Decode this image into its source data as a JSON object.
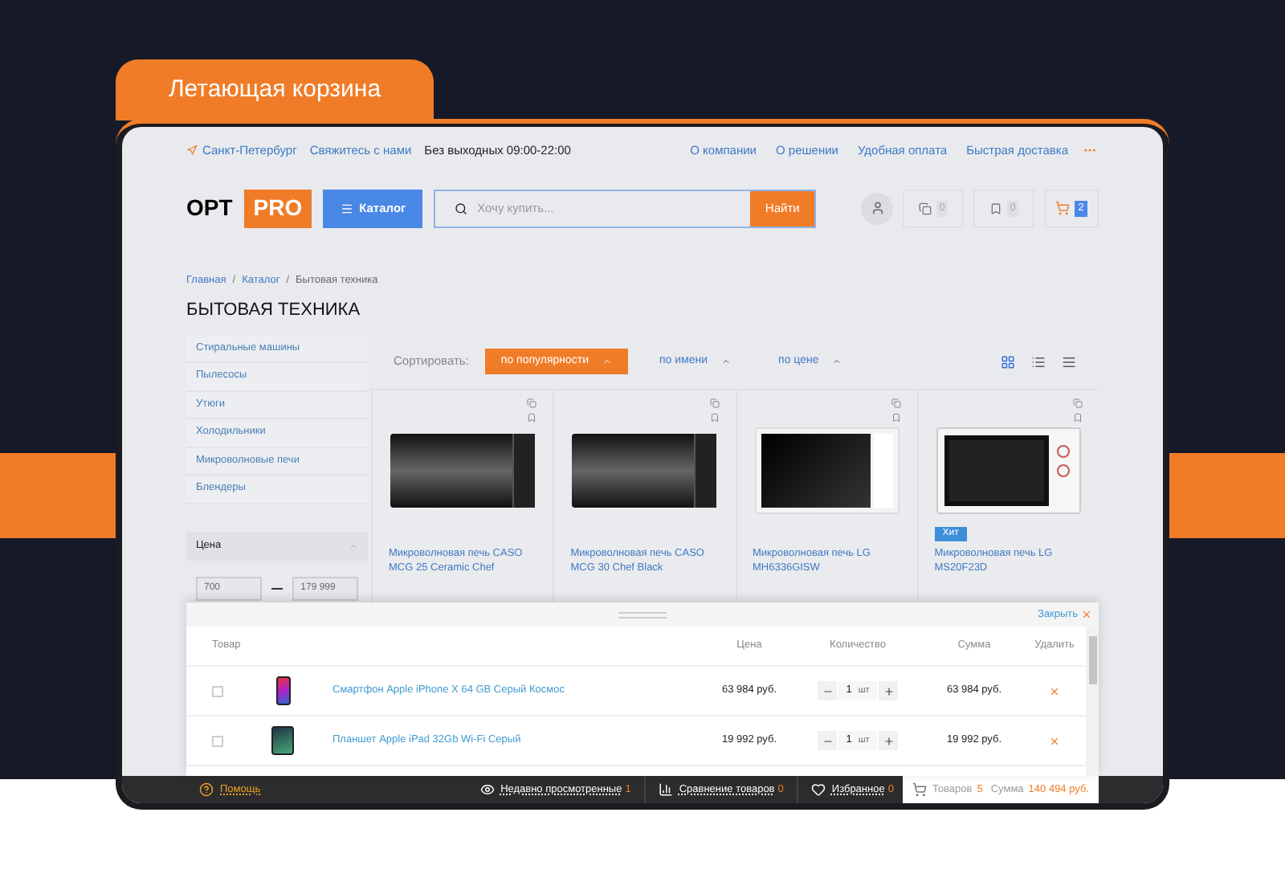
{
  "banner": {
    "label": "Летающая корзина"
  },
  "topbar": {
    "city": "Санкт-Петербург",
    "contact": "Свяжитесь с нами",
    "hours": "Без выходных 09:00-22:00",
    "links": [
      "О компании",
      "О решении",
      "Удобная оплата",
      "Быстрая доставка"
    ]
  },
  "header": {
    "logo_left": "OPT",
    "logo_right": "PRO",
    "catalog_button": "Каталог",
    "search": {
      "placeholder": "Хочу купить...",
      "button": "Найти"
    },
    "compare_count": "0",
    "favorites_count": "0",
    "cart_count": "2"
  },
  "breadcrumbs": [
    "Главная",
    "Каталог",
    "Бытовая техника"
  ],
  "breadcrumb_separator": "/",
  "page_title": "БЫТОВАЯ ТЕХНИКА",
  "sidebar": {
    "items": [
      "Стиральные машины",
      "Пылесосы",
      "Утюги",
      "Холодильники",
      "Микроволновые печи",
      "Блендеры"
    ],
    "filter": {
      "title": "Цена",
      "expanded": true,
      "min": "700",
      "max": "179 999"
    }
  },
  "sort": {
    "label": "Сортировать:",
    "options": [
      {
        "label": "по популярности",
        "selected": true
      },
      {
        "label": "по имени",
        "selected": false
      },
      {
        "label": "по цене",
        "selected": false
      }
    ]
  },
  "view_modes": [
    {
      "kind": "grid",
      "selected": true
    },
    {
      "kind": "list",
      "selected": false
    },
    {
      "kind": "table",
      "selected": false
    }
  ],
  "products": [
    {
      "kind": "mirror",
      "name": "Микроволновая печь CASO MCG 25 Ceramic Chef"
    },
    {
      "kind": "mirror",
      "name": "Микроволновая печь CASO MCG 30 Chef Black"
    },
    {
      "kind": "black",
      "name": "Микроволновая печь LG MH6336GISW"
    },
    {
      "kind": "white",
      "name": "Микроволновая печь LG MS20F23D",
      "badge": "Хит"
    }
  ],
  "cart": {
    "close": "Закрыть",
    "columns": [
      "Товар",
      "Цена",
      "Количество",
      "Сумма",
      "Удалить"
    ],
    "rows": [
      {
        "kind": "phone",
        "checked": false,
        "name": "Смартфон Apple iPhone X 64 GB Серый Космос",
        "price": "63 984 руб.",
        "qty": "1",
        "unit": "шт",
        "sum": "63 984 руб."
      },
      {
        "kind": "tablet",
        "checked": false,
        "name": "Планшет Apple iPad 32Gb Wi-Fi Серый",
        "price": "19 992 руб.",
        "qty": "1",
        "unit": "шт",
        "sum": "19 992 руб."
      }
    ]
  },
  "bottom_bar": {
    "help": "Помощь",
    "recent": {
      "label": "Недавно просмотренные",
      "count": "1"
    },
    "compare": {
      "label": "Сравнение товаров",
      "count": "0"
    },
    "favorites": {
      "label": "Избранное",
      "count": "0"
    },
    "cart": {
      "items_label": "Товаров",
      "items": "5",
      "sum_label": "Сумма",
      "sum": "140 494 руб."
    }
  }
}
